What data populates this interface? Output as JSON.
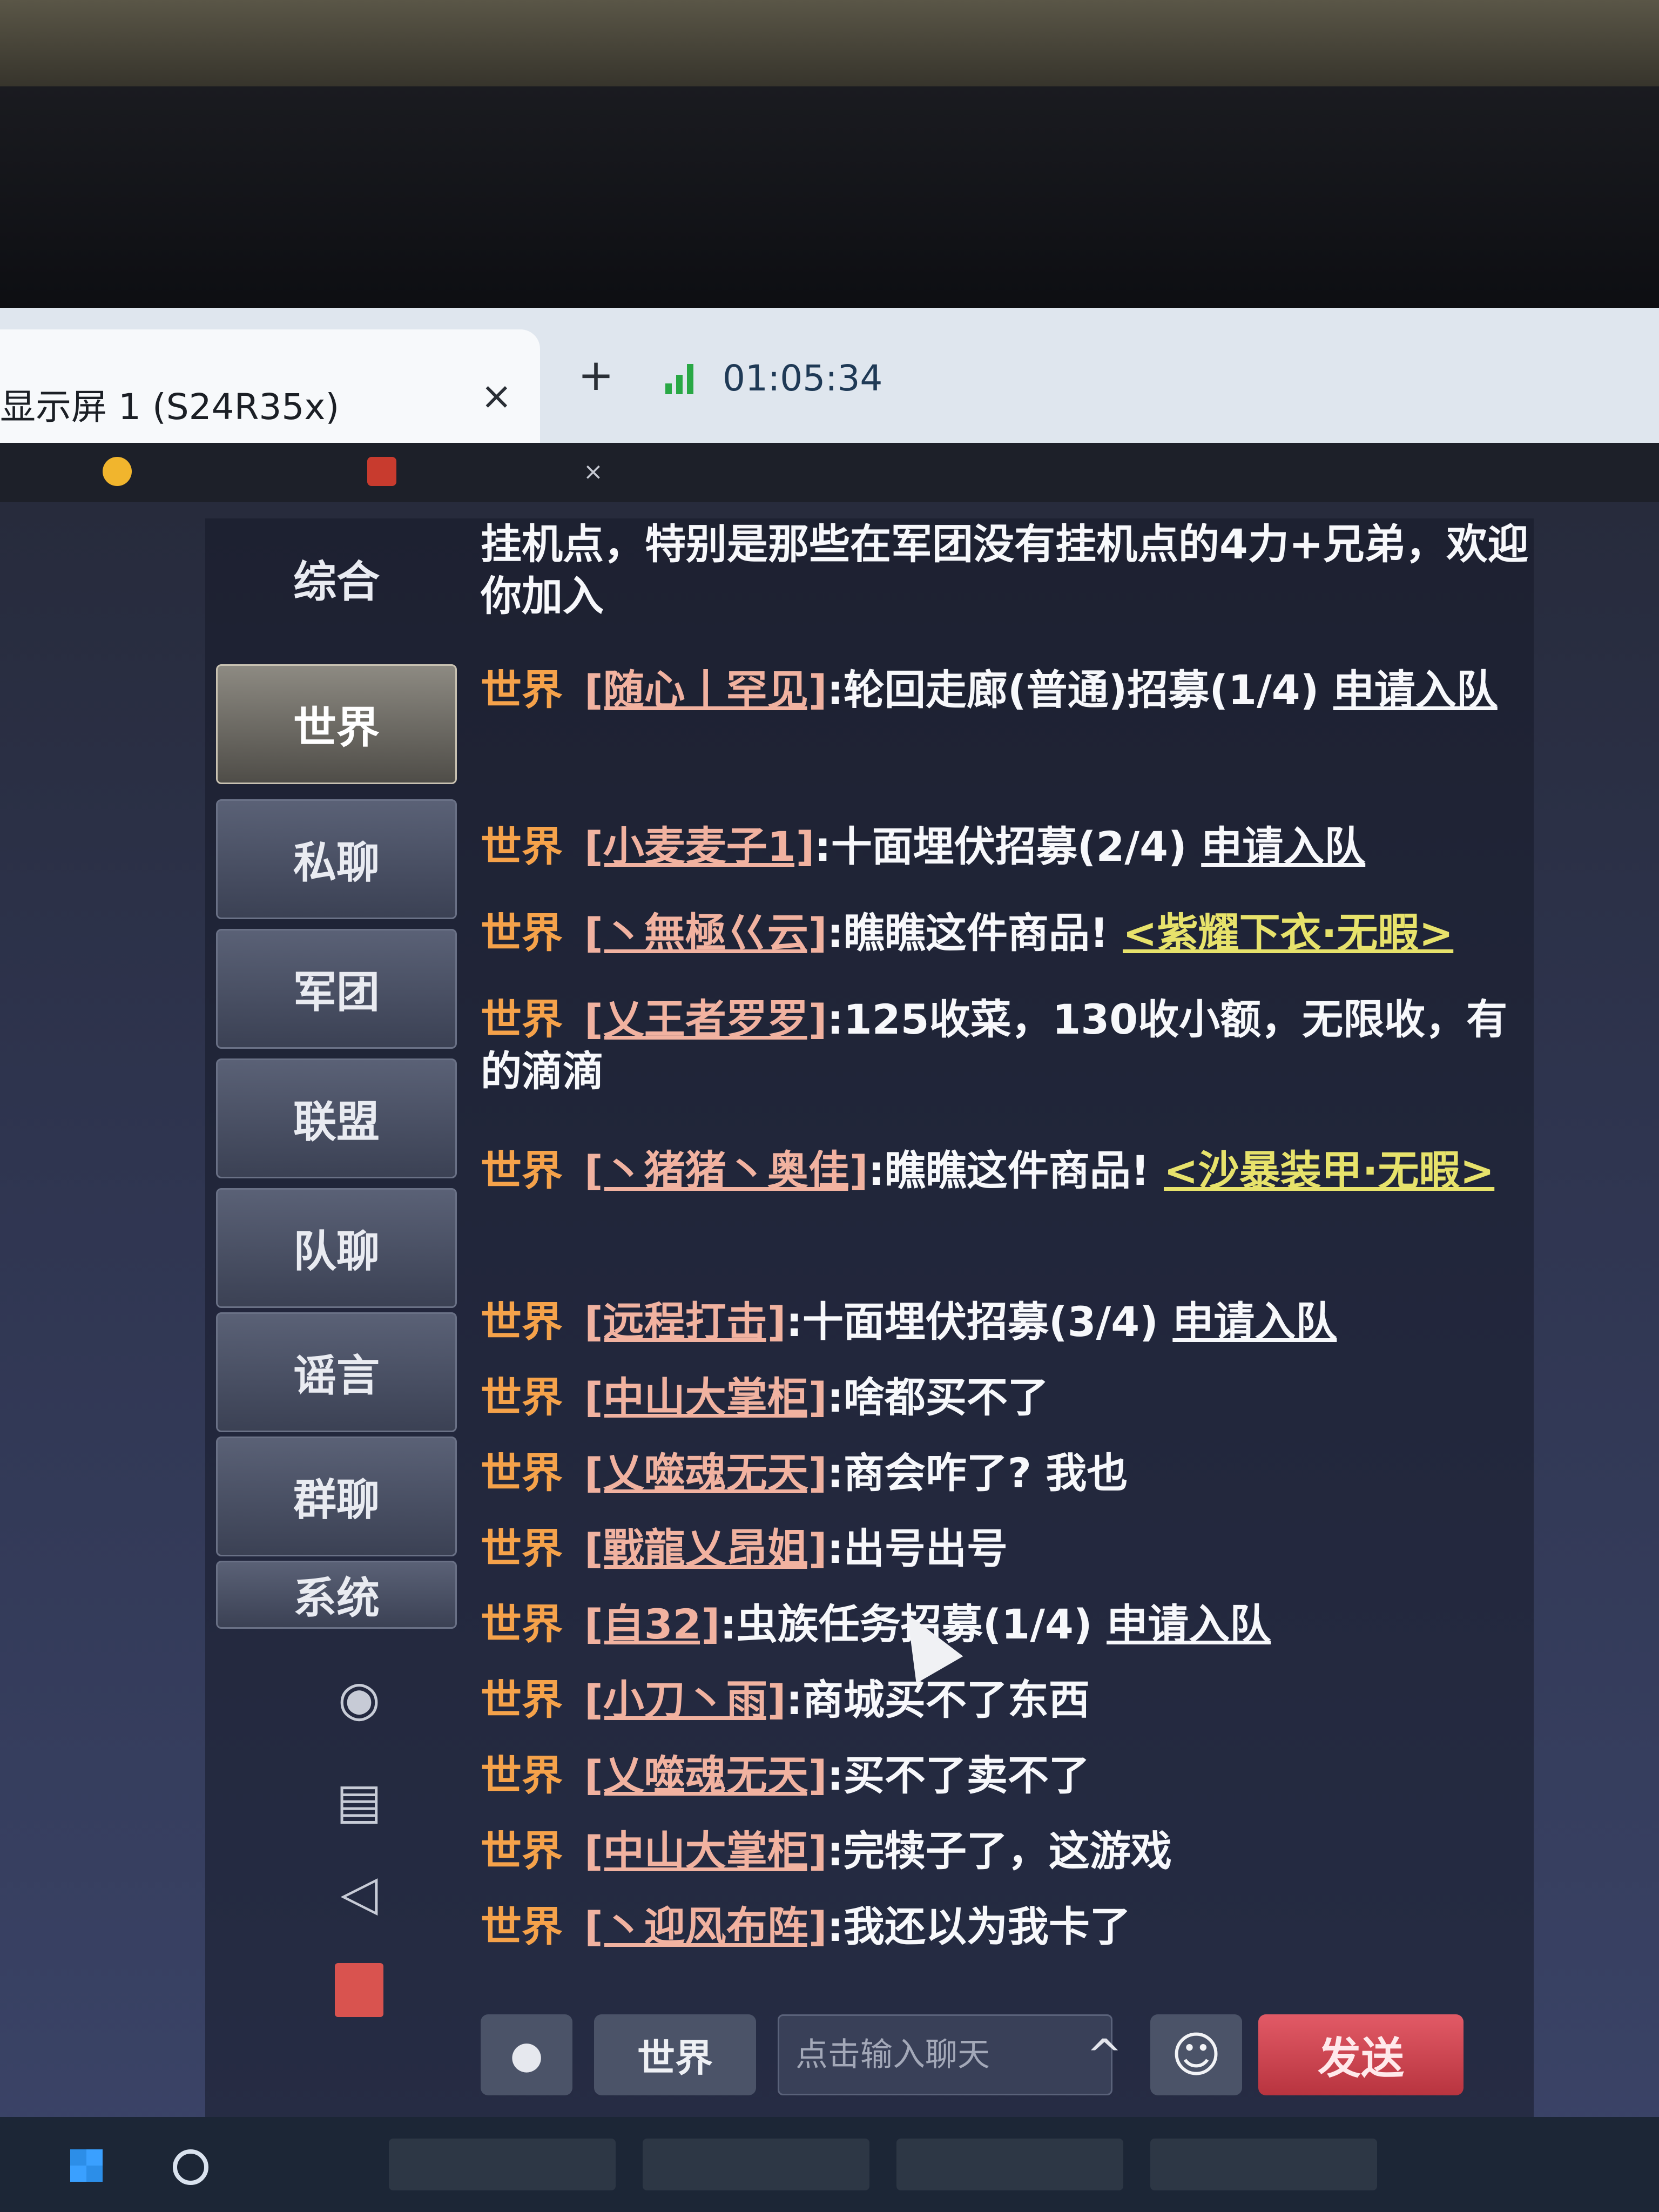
{
  "host": {
    "tab_title": "显示屏 1 (S24R35x)",
    "close_label": "×",
    "new_tab_label": "+",
    "time": "01:05:34"
  },
  "app_tabs": {
    "tab1_icon": "app-logo-icon",
    "tab2_icon": "game-logo-icon",
    "tab2_close": "×"
  },
  "channels": {
    "items": [
      "综合",
      "世界",
      "私聊",
      "军团",
      "联盟",
      "队聊",
      "谣言",
      "群聊",
      "系统"
    ],
    "active": "世界",
    "side_icons": [
      "location-pin-icon",
      "document-icon",
      "megaphone-icon",
      "red-card-icon"
    ]
  },
  "messages": {
    "m0": {
      "text": "挂机点，特别是那些在军团没有挂机点的4力+兄弟，欢迎你加入"
    },
    "m1": {
      "channel": "世界",
      "name": "[随心丨罕见]",
      "text": ":轮回走廊(普通)招募(1/4) ",
      "link": "申请入队"
    },
    "m2": {
      "channel": "世界",
      "name": "[小麦麦子1]",
      "text": ":十面埋伏招募(2/4) ",
      "link": "申请入队"
    },
    "m3": {
      "channel": "世界",
      "name": "[丶無極巜云]",
      "text": ":瞧瞧这件商品! ",
      "item": "<紫耀下衣·无暇>"
    },
    "m4": {
      "channel": "世界",
      "name": "[乂王者罗罗]",
      "text": ":125收菜，130收小额，无限收，有的滴滴"
    },
    "m5": {
      "channel": "世界",
      "name": "[丶猪猪丶奥佳]",
      "text": ":瞧瞧这件商品! ",
      "item": "<沙暴装甲·无暇>"
    },
    "m6": {
      "channel": "世界",
      "name": "[远程打击]",
      "text": ":十面埋伏招募(3/4) ",
      "link": "申请入队"
    },
    "m7": {
      "channel": "世界",
      "name": "[中山大掌柜]",
      "text": ":啥都买不了"
    },
    "m8": {
      "channel": "世界",
      "name": "[乂噬魂无天]",
      "text": ":商会咋了? 我也"
    },
    "m9": {
      "channel": "世界",
      "name": "[戰龍乂昂姐]",
      "text": ":出号出号"
    },
    "m10": {
      "channel": "世界",
      "name": "[自32]",
      "text": ":虫族任务招募(1/4) ",
      "link": "申请入队"
    },
    "m11": {
      "channel": "世界",
      "name": "[小刀丶雨]",
      "text": ":商城买不了东西"
    },
    "m12": {
      "channel": "世界",
      "name": "[乂噬魂无天]",
      "text": ":买不了卖不了"
    },
    "m13": {
      "channel": "世界",
      "name": "[中山大掌柜]",
      "text": ":完犊子了，这游戏"
    },
    "m14": {
      "channel": "世界",
      "name": "[丶迎风布阵]",
      "text": ":我还以为我卡了"
    }
  },
  "input": {
    "channel": "世界",
    "placeholder": "点击输入聊天",
    "send_label": "发送",
    "expand_icon": "^"
  },
  "colors": {
    "channel": "#f5a24a",
    "name": "#f1b2a0",
    "item_link": "#e7e26b",
    "send_button": "#d04a55"
  }
}
